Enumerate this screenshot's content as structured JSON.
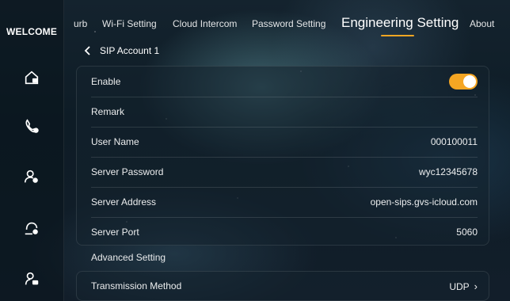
{
  "sidebar": {
    "title": "WELCOME",
    "icons": [
      "home-icon",
      "phone-icon",
      "user-settings-icon",
      "user-alert-icon",
      "user-record-icon"
    ]
  },
  "tabs": [
    {
      "label": "urb"
    },
    {
      "label": "Wi-Fi Setting"
    },
    {
      "label": "Cloud Intercom"
    },
    {
      "label": "Password Setting"
    },
    {
      "label": "Engineering Setting",
      "active": true
    },
    {
      "label": "About"
    }
  ],
  "breadcrumb": {
    "label": "SIP Account 1"
  },
  "settings": {
    "enable": {
      "label": "Enable",
      "on": true
    },
    "remark": {
      "label": "Remark",
      "value": ""
    },
    "user_name": {
      "label": "User Name",
      "value": "000100011"
    },
    "server_password": {
      "label": "Server Password",
      "value": "wyc12345678"
    },
    "server_address": {
      "label": "Server Address",
      "value": "open-sips.gvs-icloud.com"
    },
    "server_port": {
      "label": "Server Port",
      "value": "5060"
    }
  },
  "advanced": {
    "title": "Advanced Setting",
    "transmission": {
      "label": "Transmission Method",
      "value": "UDP"
    }
  },
  "colors": {
    "accent": "#f5a623"
  }
}
